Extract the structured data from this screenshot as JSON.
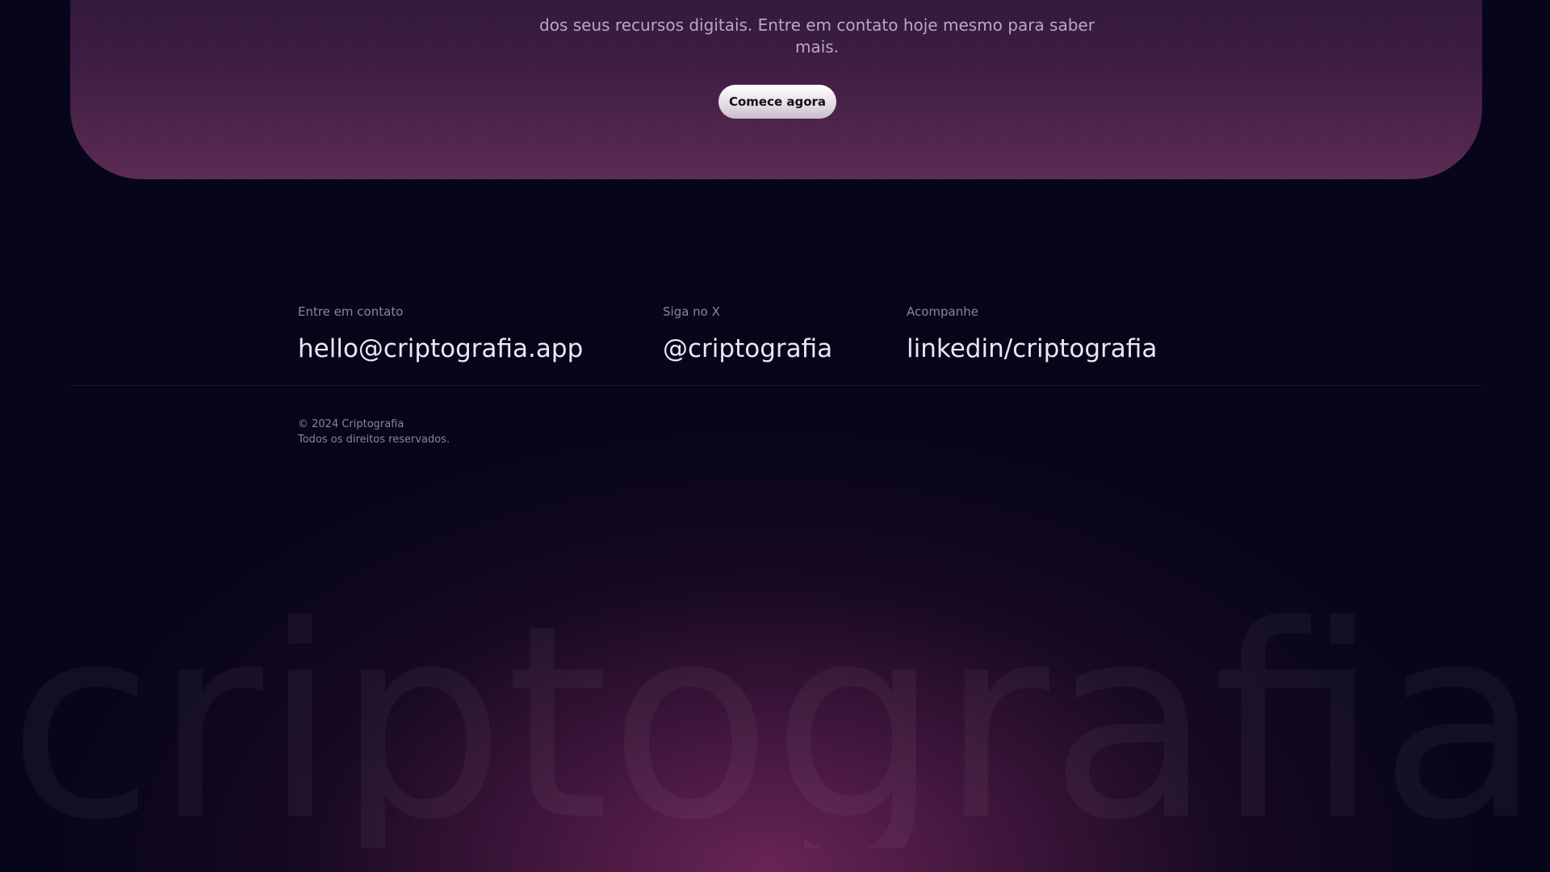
{
  "cta": {
    "text_line1": "dos seus recursos digitais. Entre em contato hoje mesmo para saber",
    "text_line2": "mais.",
    "button_label": "Comece agora"
  },
  "contacts": [
    {
      "label": "Entre em contato",
      "value": "hello@criptografia.app"
    },
    {
      "label": "Siga no X",
      "value": "@criptografia"
    },
    {
      "label": "Acompanhe",
      "value": "linkedin/criptografia"
    }
  ],
  "legal": {
    "copyright": "© 2024 Criptografia",
    "rights": "Todos os direitos reservados."
  },
  "wordmark": "criptografia",
  "colors": {
    "background": "#07051a",
    "card_top": "#2a1536",
    "card_bottom": "#5a2850",
    "text_light": "#ebe7f0",
    "text_muted": "#8a8598"
  }
}
